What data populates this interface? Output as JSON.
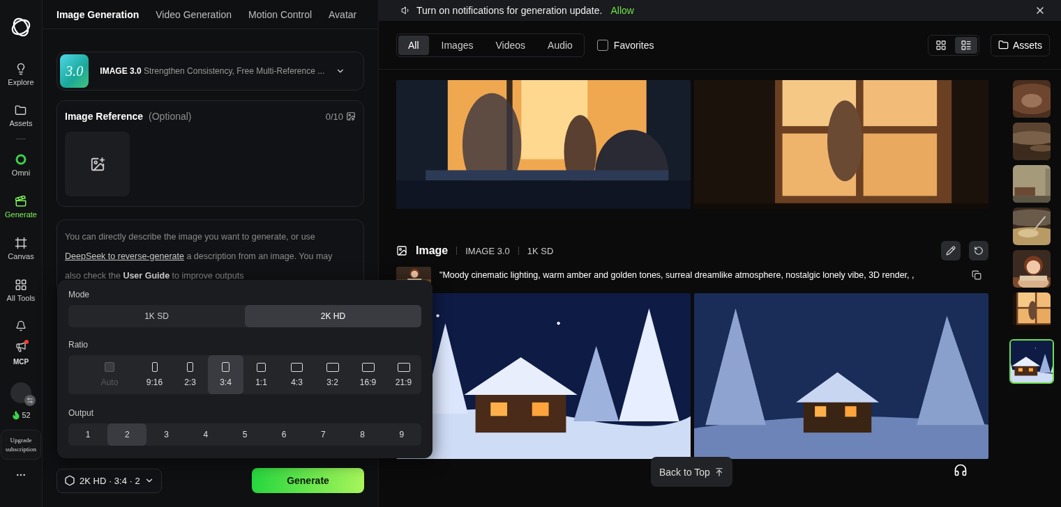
{
  "sidebar": {
    "items": [
      {
        "label": "Explore",
        "selected": false
      },
      {
        "label": "Assets",
        "selected": false
      },
      {
        "label": "Omni",
        "selected": false
      },
      {
        "label": "Generate",
        "selected": true
      },
      {
        "label": "Canvas",
        "selected": false
      },
      {
        "label": "All Tools",
        "selected": false
      }
    ],
    "announcements_unread": true,
    "mcp_label": "MCP",
    "credits": "52",
    "upgrade": "Upgrade subscription"
  },
  "tabs": [
    {
      "label": "Image Generation",
      "selected": true
    },
    {
      "label": "Video Generation",
      "selected": false
    },
    {
      "label": "Motion Control",
      "selected": false
    },
    {
      "label": "Avatar",
      "selected": false
    }
  ],
  "model": {
    "badge": "3.0",
    "name": "IMAGE 3.0",
    "description": "Strengthen Consistency, Free Multi-Reference ..."
  },
  "image_reference": {
    "title": "Image Reference",
    "hint": "(Optional)",
    "count": "0/10"
  },
  "prompt": {
    "parts": [
      {
        "kind": "text",
        "text": "You can directly describe the image you want to generate, or use "
      },
      {
        "kind": "link",
        "text": "DeepSeek to reverse-generate"
      },
      {
        "kind": "text",
        "text": " a description from an image. You may also check the "
      },
      {
        "kind": "strong_link",
        "text": "User Guide"
      },
      {
        "kind": "text",
        "text": " to improve outputs"
      }
    ]
  },
  "settings_popup": {
    "mode": {
      "label": "Mode",
      "options": [
        {
          "label": "1K SD",
          "selected": false
        },
        {
          "label": "2K HD",
          "selected": true
        }
      ]
    },
    "ratio": {
      "label": "Ratio",
      "options": [
        {
          "label": "Auto",
          "selected": false,
          "disabled": true
        },
        {
          "label": "9:16",
          "selected": false,
          "disabled": false
        },
        {
          "label": "2:3",
          "selected": false,
          "disabled": false
        },
        {
          "label": "3:4",
          "selected": true,
          "disabled": false
        },
        {
          "label": "1:1",
          "selected": false,
          "disabled": false
        },
        {
          "label": "4:3",
          "selected": false,
          "disabled": false
        },
        {
          "label": "3:2",
          "selected": false,
          "disabled": false
        },
        {
          "label": "16:9",
          "selected": false,
          "disabled": false
        },
        {
          "label": "21:9",
          "selected": false,
          "disabled": false
        }
      ]
    },
    "output": {
      "label": "Output",
      "options": [
        {
          "label": "1",
          "selected": false
        },
        {
          "label": "2",
          "selected": true
        },
        {
          "label": "3",
          "selected": false
        },
        {
          "label": "4",
          "selected": false
        },
        {
          "label": "5",
          "selected": false
        },
        {
          "label": "6",
          "selected": false
        },
        {
          "label": "7",
          "selected": false
        },
        {
          "label": "8",
          "selected": false
        },
        {
          "label": "9",
          "selected": false
        }
      ]
    }
  },
  "summary": "2K HD · 3:4 · 2",
  "generate": "Generate",
  "notification": {
    "text": "Turn on notifications for generation update.",
    "action": "Allow"
  },
  "filters": [
    {
      "label": "All",
      "selected": true
    },
    {
      "label": "Images",
      "selected": false
    },
    {
      "label": "Videos",
      "selected": false
    },
    {
      "label": "Audio",
      "selected": false
    }
  ],
  "favorites": {
    "label": "Favorites",
    "checked": false
  },
  "view_modes": [
    {
      "selected": false
    },
    {
      "selected": true
    }
  ],
  "assets_button": "Assets",
  "results": [
    {
      "images": [
        {
          "kind": "picture"
        },
        {
          "kind": "picture"
        }
      ]
    },
    {
      "title": "Image",
      "model": "IMAGE 3.0",
      "resolution": "1K SD",
      "prompt": "\"Moody cinematic lighting, warm amber and golden tones, surreal dreamlike atmosphere, nostalgic lonely vibe, 3D render, ,",
      "images": [
        {
          "kind": "picture"
        },
        {
          "kind": "picture"
        }
      ]
    }
  ],
  "thumbnails": [
    {
      "kind": "picture",
      "selected": false
    },
    {
      "kind": "picture",
      "selected": false
    },
    {
      "kind": "picture",
      "selected": false
    },
    {
      "kind": "picture",
      "selected": false
    },
    {
      "kind": "picture",
      "selected": false
    },
    {
      "kind": "picture",
      "selected": false
    },
    {
      "kind": "picture",
      "selected": true
    }
  ],
  "back_to_top": "Back to Top"
}
